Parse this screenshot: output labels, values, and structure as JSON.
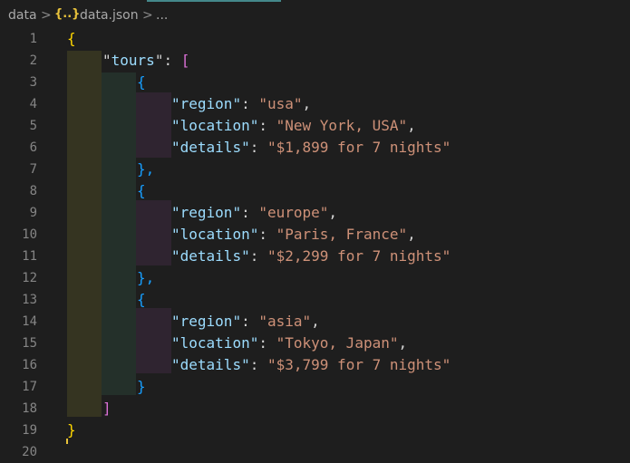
{
  "breadcrumb": {
    "folder": "data",
    "separator": ">",
    "json_icon": "{..}",
    "file": "data.json",
    "more": "..."
  },
  "editor": {
    "line_numbers": [
      "1",
      "2",
      "3",
      "4",
      "5",
      "6",
      "7",
      "8",
      "9",
      "10",
      "11",
      "12",
      "13",
      "14",
      "15",
      "16",
      "17",
      "18",
      "19",
      "20"
    ],
    "root_open": "{",
    "root_close": "}",
    "array_key": "tours",
    "array_open": "[",
    "array_close": "]",
    "object_open": "{",
    "object_close_comma": "},",
    "object_close": "}",
    "tours": [
      {
        "region": "usa",
        "location": "New York, USA",
        "details": "$1,899 for 7 nights"
      },
      {
        "region": "europe",
        "location": "Paris, France",
        "details": "$2,299 for 7 nights"
      },
      {
        "region": "asia",
        "location": "Tokyo, Japan",
        "details": "$3,799 for 7 nights"
      }
    ],
    "field_keys": {
      "region": "region",
      "location": "location",
      "details": "details"
    }
  },
  "colors": {
    "background": "#1e1e1e",
    "key": "#9cdcfe",
    "string": "#ce9178",
    "bracket_level1": "#ffd700",
    "bracket_level2": "#da70d6",
    "bracket_level3": "#179fff",
    "line_number": "#858585"
  },
  "icons": {
    "json_file": "json-braces-icon",
    "chevron": "chevron-right-icon"
  }
}
